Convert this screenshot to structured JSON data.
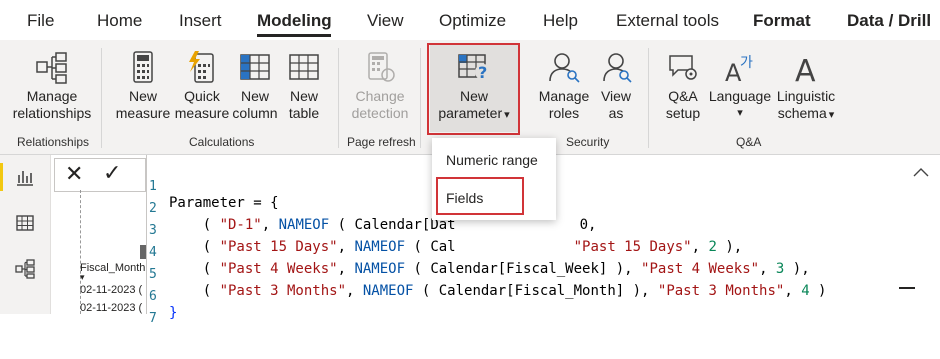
{
  "tabs": {
    "file": "File",
    "home": "Home",
    "insert": "Insert",
    "modeling": "Modeling",
    "view": "View",
    "optimize": "Optimize",
    "help": "Help",
    "external_tools": "External tools",
    "format": "Format",
    "data_drill": "Data / Drill"
  },
  "ribbon": {
    "relationships": {
      "btn1": "Manage",
      "btn2": "relationships",
      "group": "Relationships"
    },
    "calculations": {
      "new_measure": [
        "New",
        "measure"
      ],
      "quick_measure": [
        "Quick",
        "measure"
      ],
      "new_column": [
        "New",
        "column"
      ],
      "new_table": [
        "New",
        "table"
      ],
      "group": "Calculations"
    },
    "page_refresh": {
      "btn": [
        "Change",
        "detection"
      ],
      "group": "Page refresh"
    },
    "parameters": {
      "btn": [
        "New",
        "parameter"
      ]
    },
    "security": {
      "manage_roles": [
        "Manage",
        "roles"
      ],
      "view_as": [
        "View",
        "as"
      ],
      "group": "Security"
    },
    "qa": {
      "qa_setup": [
        "Q&A",
        "setup"
      ],
      "language": "Language",
      "linguistic": [
        "Linguistic",
        "schema"
      ],
      "group": "Q&A"
    }
  },
  "dropdown": {
    "items": [
      "Numeric range",
      "Fields"
    ]
  },
  "formula_bar": {
    "close": "✕",
    "check": "✓"
  },
  "column_header": "Fiscal_Month",
  "rows": [
    "02-11-2023 (",
    "02-11-2023 ("
  ],
  "colors": {
    "accent": "#d13438",
    "selected_bg": "#e1dfdd",
    "keyword": "#0451a5",
    "string": "#a31515",
    "number": "#098658"
  },
  "code": {
    "line_numbers": [
      "1",
      "2",
      "3",
      "4",
      "5",
      "6",
      "7"
    ],
    "l1": "Parameter = {",
    "l2a": "    ( ",
    "l2b": "\"D-1\"",
    "l2c": ", ",
    "l2d": "NAMEOF",
    "l2e": " ( Calendar[Dat",
    "l2f": "0,",
    "l3a": "    ( ",
    "l3b": "\"Past 15 Days\"",
    "l3c": ", ",
    "l3d": "NAMEOF",
    "l3e": " ( Cal",
    "l3f": "\"Past 15 Days\"",
    "l3g": ", ",
    "l3h": "2",
    "l3i": " ),",
    "l4a": "    ( ",
    "l4b": "\"Past 4 Weeks\"",
    "l4c": ", ",
    "l4d": "NAMEOF",
    "l4e": " ( Calendar[Fiscal_Week] ), ",
    "l4f": "\"Past 4 Weeks\"",
    "l4g": ", ",
    "l4h": "3",
    "l4i": " ),",
    "l5a": "    ( ",
    "l5b": "\"Past 3 Months\"",
    "l5c": ", ",
    "l5d": "NAMEOF",
    "l5e": " ( Calendar[Fiscal_Month] ), ",
    "l5f": "\"Past 3 Months\"",
    "l5g": ", ",
    "l5h": "4",
    "l5i": " )",
    "l6": "}",
    "l7": ""
  },
  "icons": {
    "caret": "⌄",
    "scroll_up": "︿",
    "sort": "▾"
  }
}
